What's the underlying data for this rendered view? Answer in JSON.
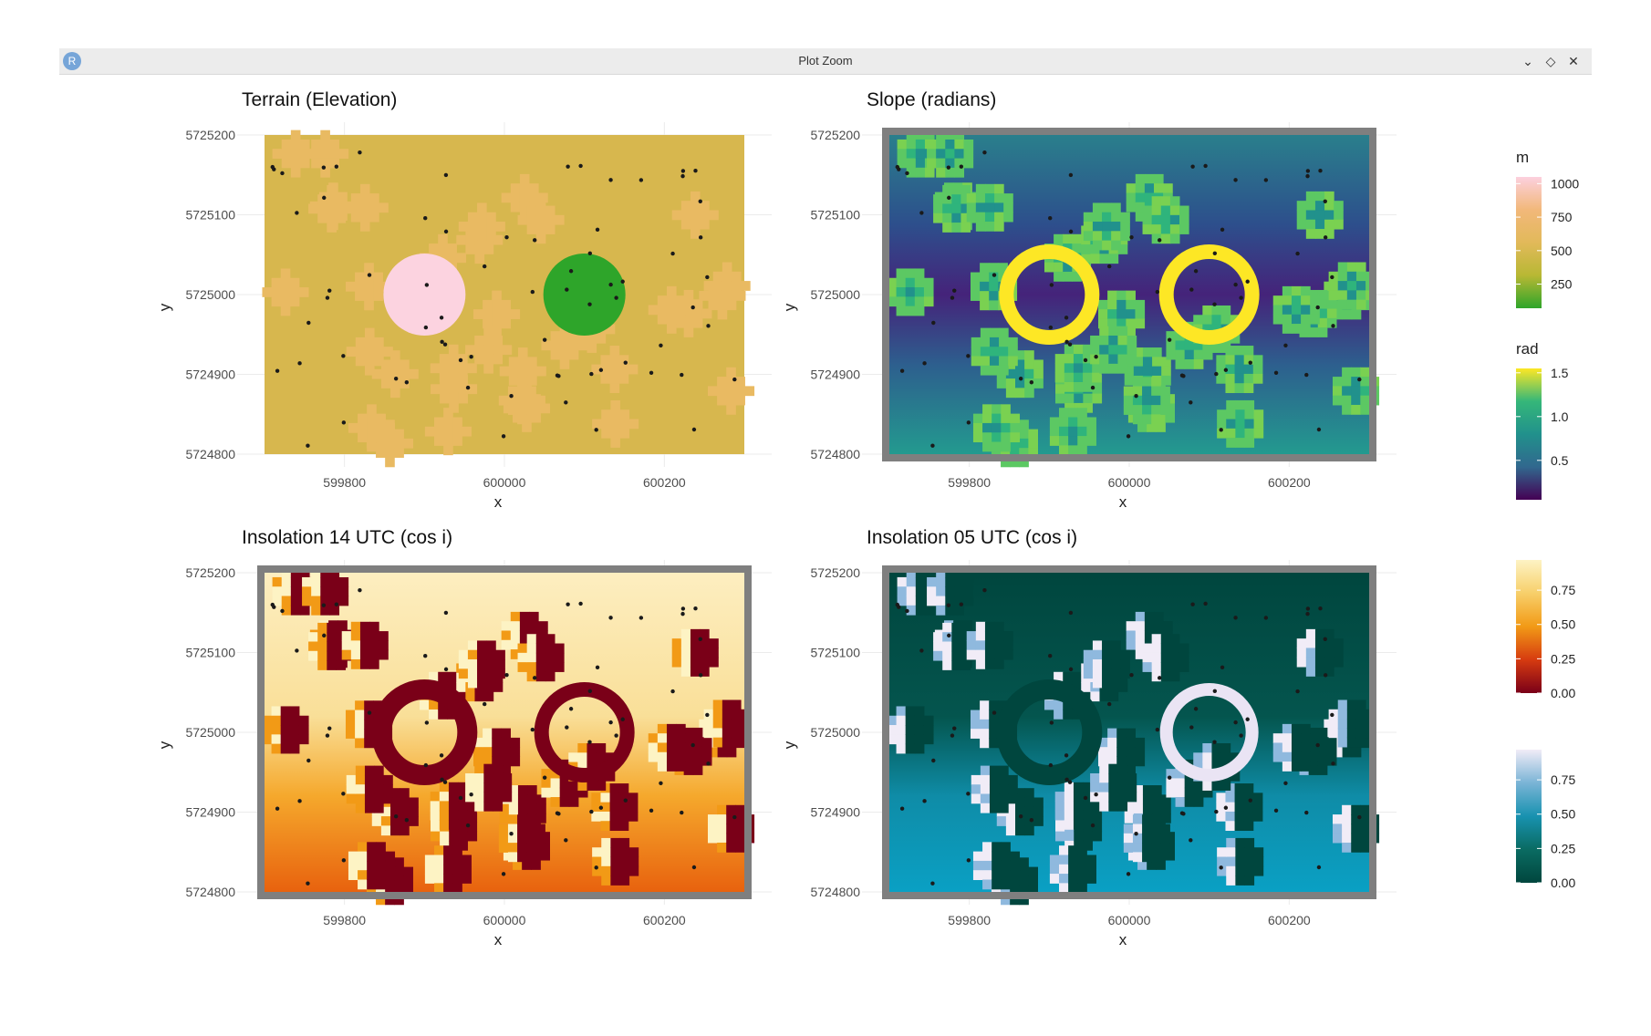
{
  "window": {
    "app_icon": "R",
    "title": "Plot Zoom",
    "controls": {
      "minimize": "⌄",
      "maximize": "◇",
      "close": "✕"
    }
  },
  "chart_data": [
    {
      "type": "heatmap",
      "title": "Terrain (Elevation)",
      "xlabel": "x",
      "ylabel": "y",
      "x_ticks": [
        599800,
        600000,
        600200
      ],
      "y_ticks": [
        5724800,
        5724900,
        5725000,
        5725100,
        5725200
      ],
      "xlim": [
        599700,
        600300
      ],
      "ylim": [
        5724800,
        5725200
      ],
      "fill_description": "background ~400 m, pink hill ~1000 m near (599900, 5725000), green pit ~150 m near (600100, 5725000), scattered ~500 m bumps",
      "legend": {
        "title": "m",
        "breaks": [
          "1000",
          "750",
          "500",
          "250"
        ],
        "colors": [
          "#2ea52a",
          "#b8b834",
          "#e2b95a",
          "#f2b87a",
          "#fcd0de"
        ]
      }
    },
    {
      "type": "heatmap",
      "title": "Slope (radians)",
      "xlabel": "x",
      "ylabel": "y",
      "x_ticks": [
        599800,
        600000,
        600200
      ],
      "y_ticks": [
        5724800,
        5724900,
        5725000,
        5725100,
        5725200
      ],
      "xlim": [
        599700,
        600300
      ],
      "ylim": [
        5724800,
        5725200
      ],
      "legend": {
        "title": "rad",
        "breaks": [
          "1.5",
          "1.0",
          "0.5"
        ],
        "colors": [
          "#440154",
          "#31688e",
          "#21918c",
          "#35b779",
          "#fde725"
        ]
      }
    },
    {
      "type": "heatmap",
      "title": "Insolation 14 UTC (cos i)",
      "xlabel": "x",
      "ylabel": "y",
      "x_ticks": [
        599800,
        600000,
        600200
      ],
      "y_ticks": [
        5724800,
        5724900,
        5725000,
        5725100,
        5725200
      ],
      "xlim": [
        599700,
        600300
      ],
      "ylim": [
        5724800,
        5725200
      ],
      "legend": {
        "title": "",
        "breaks": [
          "0.75",
          "0.50",
          "0.25",
          "0.00"
        ],
        "colors": [
          "#7a0018",
          "#d63b10",
          "#f29a16",
          "#f7cf6a",
          "#fdf3c4"
        ]
      }
    },
    {
      "type": "heatmap",
      "title": "Insolation 05 UTC (cos i)",
      "xlabel": "x",
      "ylabel": "y",
      "x_ticks": [
        599800,
        600000,
        600200
      ],
      "y_ticks": [
        5724800,
        5724900,
        5725000,
        5725100,
        5725200
      ],
      "xlim": [
        599700,
        600300
      ],
      "ylim": [
        5724800,
        5725200
      ],
      "legend": {
        "title": "",
        "breaks": [
          "0.75",
          "0.50",
          "0.25",
          "0.00"
        ],
        "colors": [
          "#00463e",
          "#0a6b62",
          "#1892b0",
          "#7ab4d6",
          "#f1ecf7"
        ]
      }
    }
  ]
}
